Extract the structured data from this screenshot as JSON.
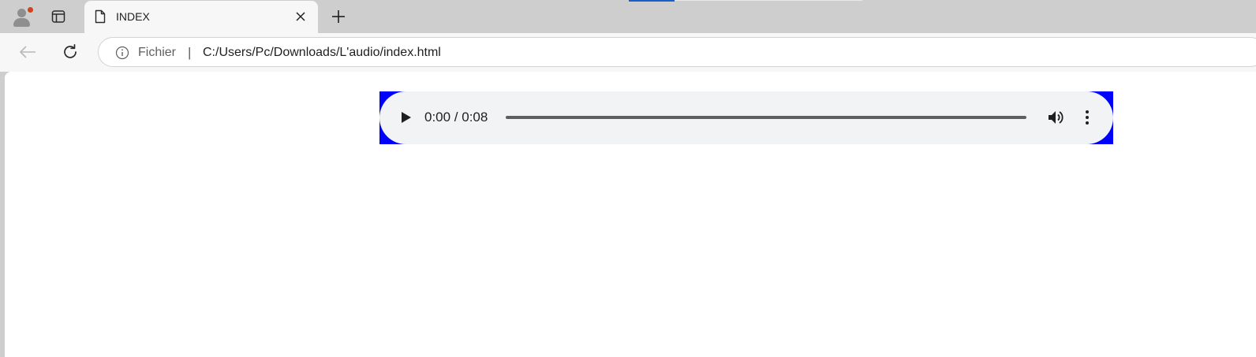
{
  "browser": {
    "tab": {
      "title": "INDEX",
      "favicon": "page-icon"
    },
    "address_bar": {
      "scheme_label": "Fichier",
      "separator": "|",
      "url": "C:/Users/Pc/Downloads/L'audio/index.html"
    },
    "icons": {
      "profile": "profile-avatar-icon",
      "tab_actions": "tab-actions-icon",
      "close_tab": "close-icon",
      "new_tab": "plus-icon",
      "back": "back-arrow-icon",
      "reload": "reload-icon",
      "info": "info-icon"
    }
  },
  "page": {
    "background_color": "#0000ff",
    "audio_player": {
      "time_display": "0:00 / 0:08",
      "progress": 0,
      "icons": {
        "play": "play-icon",
        "volume": "volume-icon",
        "more": "more-options-icon"
      }
    }
  }
}
